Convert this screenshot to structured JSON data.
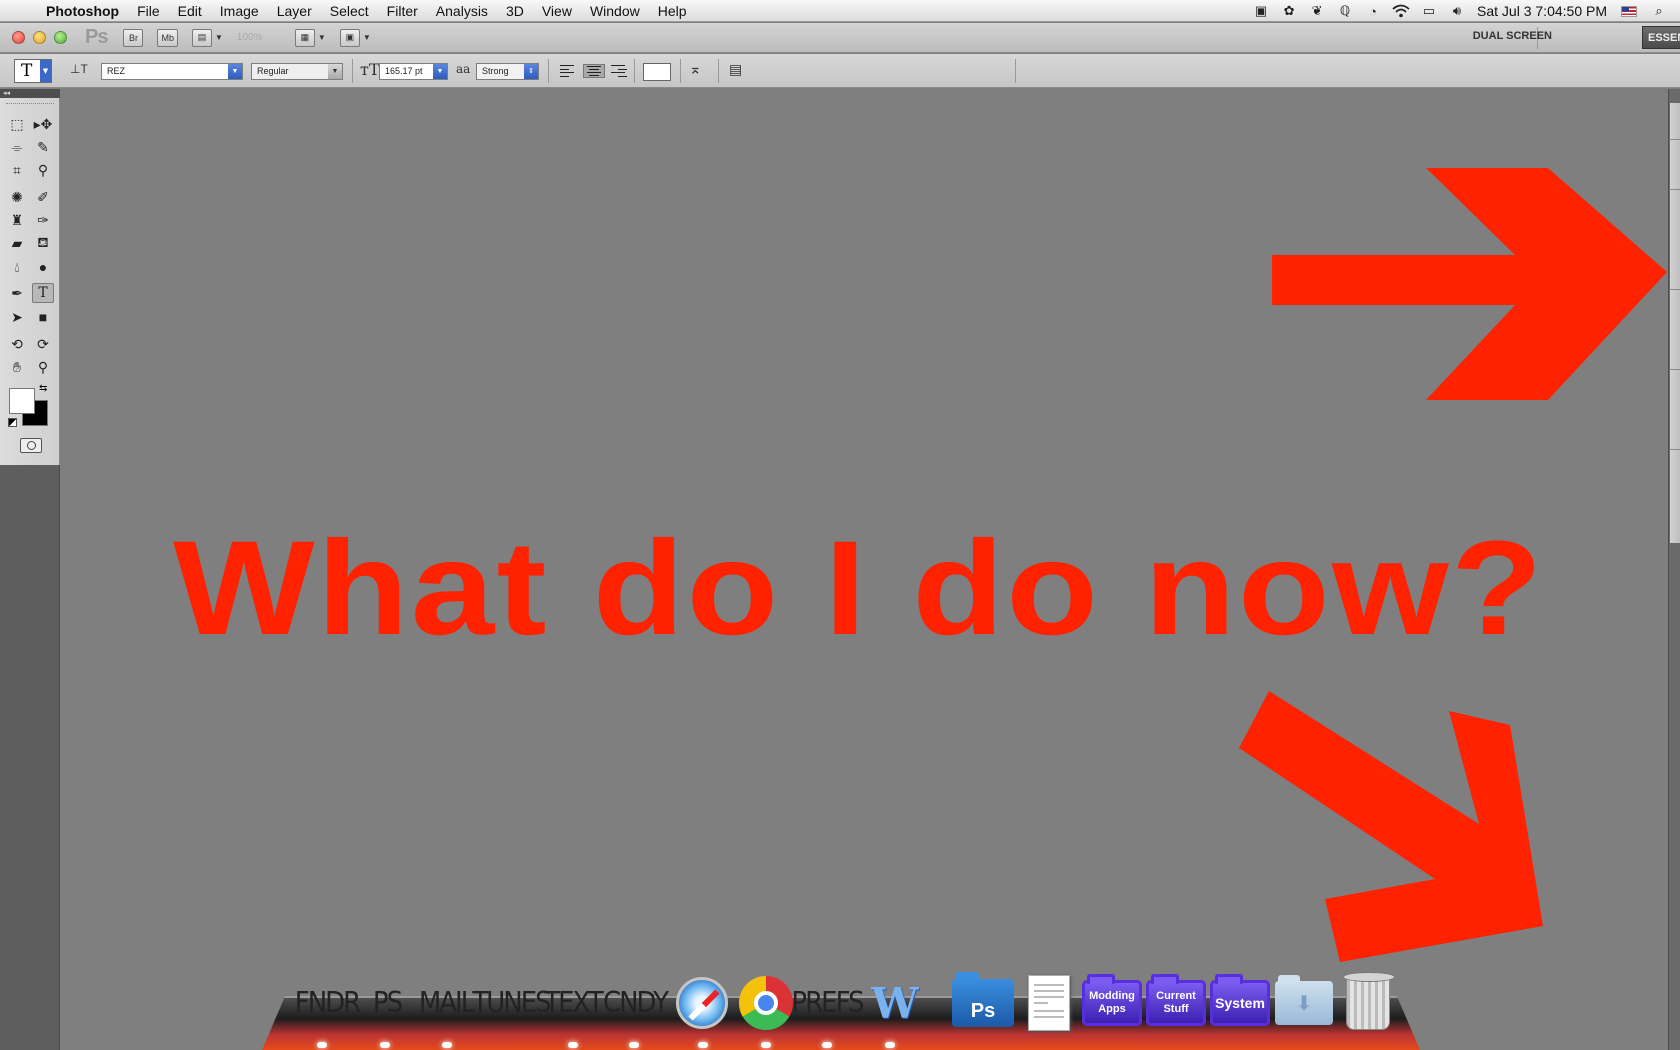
{
  "menubar": {
    "app_name": "Photoshop",
    "items": [
      "File",
      "Edit",
      "Image",
      "Layer",
      "Select",
      "Filter",
      "Analysis",
      "3D",
      "View",
      "Window",
      "Help"
    ],
    "clock": "Sat Jul 3  7:04:50 PM"
  },
  "appbar": {
    "logo": "Ps",
    "bridge_label": "Br",
    "minibridge_label": "Mb",
    "zoom": "100%",
    "workspace_dual": "DUAL SCREEN",
    "workspace_active": "ESSENTIALS"
  },
  "options": {
    "tool_glyph": "T",
    "font_family": "REZ",
    "font_style": "Regular",
    "font_size": "165.17 pt",
    "antialias_label": "aa",
    "antialias": "Strong",
    "text_color": "#ffffff"
  },
  "tools": {
    "foreground": "#ffffff",
    "background": "#000000",
    "selected": "type-tool"
  },
  "canvas": {
    "background": "#7f7f7f",
    "headline": "What do I do now?",
    "ink_color": "#ff2200"
  },
  "dock": {
    "text_items": [
      "FNDR",
      "PS",
      "MAIL",
      "TUNES",
      "TEXT",
      "CNDY",
      "PREFS"
    ],
    "app_ps_label": "Ps",
    "folders": [
      {
        "line1": "Modding",
        "line2": "Apps"
      },
      {
        "line1": "Current",
        "line2": "Stuff"
      },
      {
        "line1": "System",
        "line2": ""
      }
    ]
  }
}
